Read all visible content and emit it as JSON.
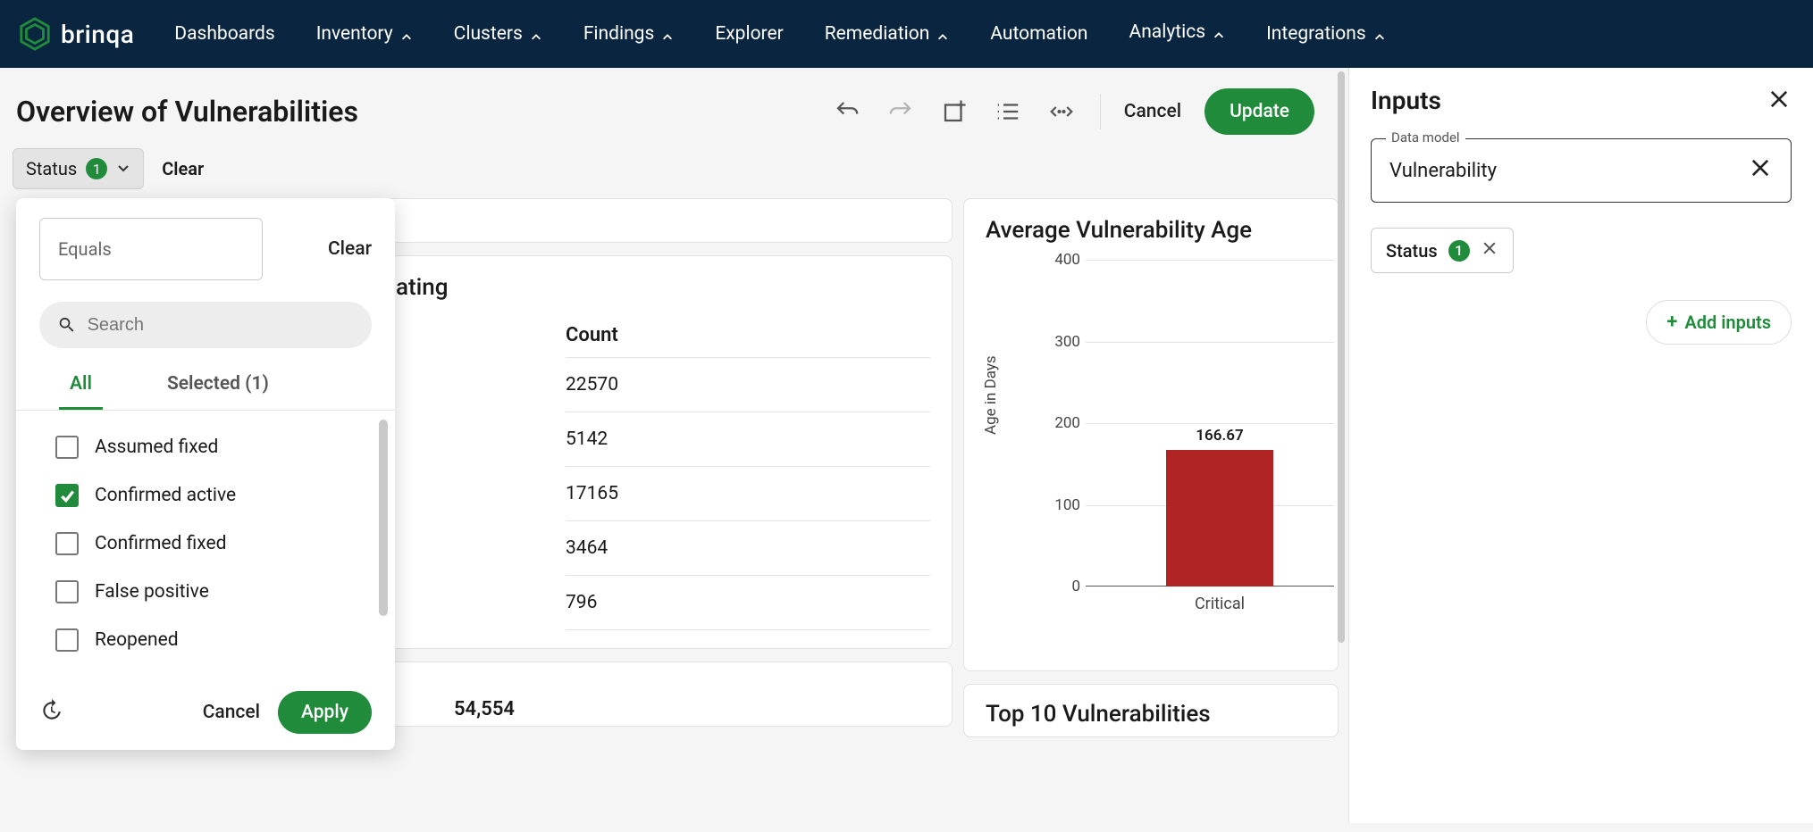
{
  "brand": "brinqa",
  "nav": {
    "dashboards": "Dashboards",
    "inventory": "Inventory",
    "clusters": "Clusters",
    "findings": "Findings",
    "explorer": "Explorer",
    "remediation": "Remediation",
    "automation": "Automation",
    "analytics": "Analytics",
    "integrations": "Integrations"
  },
  "page": {
    "title": "Overview of Vulnerabilities",
    "cancel": "Cancel",
    "update": "Update"
  },
  "filters": {
    "status_label": "Status",
    "status_count": "1",
    "clear": "Clear"
  },
  "popover": {
    "equals": "Equals",
    "clear": "Clear",
    "search_placeholder": "Search",
    "tab_all": "All",
    "tab_selected": "Selected (1)",
    "options": {
      "assumed_fixed": "Assumed fixed",
      "confirmed_active": "Confirmed active",
      "confirmed_fixed": "Confirmed fixed",
      "false_positive": "False positive",
      "reopened": "Reopened"
    },
    "cancel": "Cancel",
    "apply": "Apply"
  },
  "rating_card": {
    "title_suffix": "ating",
    "count_header": "Count",
    "rows": [
      "22570",
      "5142",
      "17165",
      "3464",
      "796"
    ],
    "big_number": "54,554"
  },
  "age_card": {
    "title": "Average Vulnerability Age",
    "y_axis": "Age in Days",
    "ticks": {
      "t0": "0",
      "t100": "100",
      "t200": "200",
      "t300": "300",
      "t400": "400"
    },
    "bar_value": "166.67",
    "x_category": "Critical"
  },
  "bottom_card": {
    "title": "Top 10 Vulnerabilities"
  },
  "panel": {
    "title": "Inputs",
    "data_model_label": "Data model",
    "data_model_value": "Vulnerability",
    "status_label": "Status",
    "status_count": "1",
    "add_inputs": "Add inputs"
  },
  "chart_data": {
    "type": "bar",
    "title": "Average Vulnerability Age",
    "xlabel": "",
    "ylabel": "Age in Days",
    "ylim": [
      0,
      400
    ],
    "categories": [
      "Critical"
    ],
    "values": [
      166.67
    ]
  }
}
